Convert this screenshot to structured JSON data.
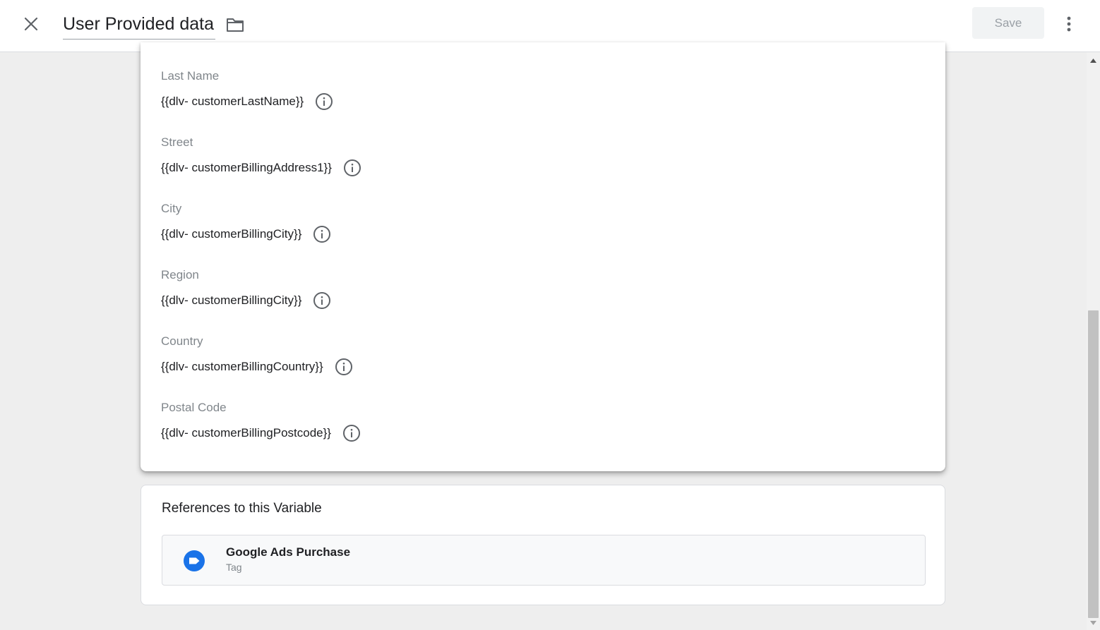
{
  "header": {
    "title": "User Provided data",
    "save_label": "Save"
  },
  "fields": [
    {
      "label": "Last Name",
      "value": "{{dlv- customerLastName}}"
    },
    {
      "label": "Street",
      "value": "{{dlv- customerBillingAddress1}}"
    },
    {
      "label": "City",
      "value": "{{dlv- customerBillingCity}}"
    },
    {
      "label": "Region",
      "value": "{{dlv- customerBillingCity}}"
    },
    {
      "label": "Country",
      "value": "{{dlv- customerBillingCountry}}"
    },
    {
      "label": "Postal Code",
      "value": "{{dlv- customerBillingPostcode}}"
    }
  ],
  "references": {
    "title": "References to this Variable",
    "items": [
      {
        "name": "Google Ads Purchase",
        "type": "Tag",
        "icon": "tag-icon",
        "icon_color": "#1a73e8"
      }
    ]
  },
  "colors": {
    "accent": "#1a73e8",
    "background": "#eeeeee",
    "label_gray": "#80868b"
  }
}
